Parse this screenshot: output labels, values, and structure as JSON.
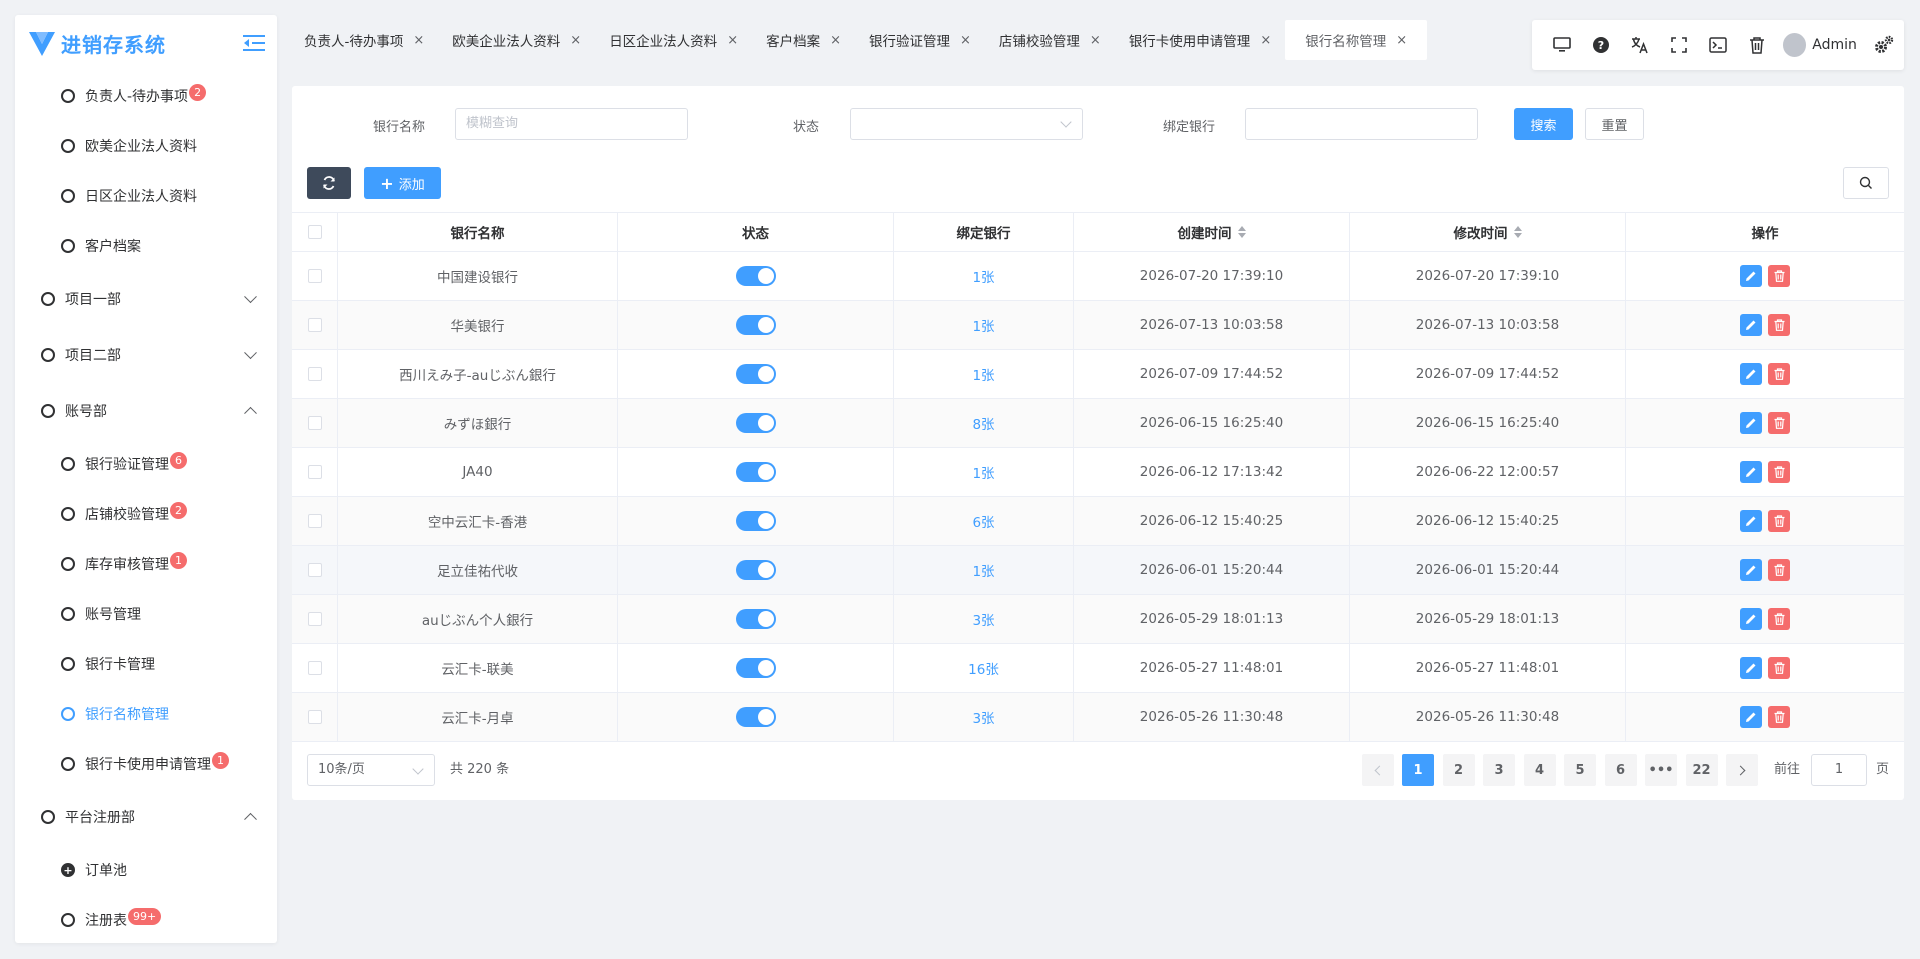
{
  "app": {
    "title": "进销存系统"
  },
  "sidebar": {
    "items": [
      {
        "label": "负责人-待办事项",
        "badge": "2",
        "type": "sub"
      },
      {
        "label": "欧美企业法人资料",
        "badge": "",
        "type": "sub"
      },
      {
        "label": "日区企业法人资料",
        "badge": "",
        "type": "sub"
      },
      {
        "label": "客户档案",
        "badge": "",
        "type": "sub"
      },
      {
        "label": "项目一部",
        "badge": "",
        "type": "group",
        "expanded": false
      },
      {
        "label": "项目二部",
        "badge": "",
        "type": "group",
        "expanded": false
      },
      {
        "label": "账号部",
        "badge": "",
        "type": "group",
        "expanded": true
      },
      {
        "label": "银行验证管理",
        "badge": "6",
        "type": "sub"
      },
      {
        "label": "店铺校验管理",
        "badge": "2",
        "type": "sub"
      },
      {
        "label": "库存审核管理",
        "badge": "1",
        "type": "sub"
      },
      {
        "label": "账号管理",
        "badge": "",
        "type": "sub"
      },
      {
        "label": "银行卡管理",
        "badge": "",
        "type": "sub"
      },
      {
        "label": "银行名称管理",
        "badge": "",
        "type": "sub",
        "active": true
      },
      {
        "label": "银行卡使用申请管理",
        "badge": "1",
        "type": "sub"
      },
      {
        "label": "平台注册部",
        "badge": "",
        "type": "group",
        "expanded": true
      },
      {
        "label": "订单池",
        "badge": "",
        "type": "sub",
        "plus": true
      },
      {
        "label": "注册表",
        "badge": "99+",
        "type": "sub"
      }
    ]
  },
  "tabs": [
    {
      "label": "负责人-待办事项",
      "active": false
    },
    {
      "label": "欧美企业法人资料",
      "active": false
    },
    {
      "label": "日区企业法人资料",
      "active": false
    },
    {
      "label": "客户档案",
      "active": false
    },
    {
      "label": "银行验证管理",
      "active": false
    },
    {
      "label": "店铺校验管理",
      "active": false
    },
    {
      "label": "银行卡使用申请管理",
      "active": false
    },
    {
      "label": "银行名称管理",
      "active": true
    }
  ],
  "tab_close": "×",
  "toolbar": {
    "user": "Admin"
  },
  "search": {
    "bank_name_label": "银行名称",
    "bank_name_placeholder": "模糊查询",
    "status_label": "状态",
    "bound_bank_label": "绑定银行",
    "search_button": "搜索",
    "reset_button": "重置"
  },
  "actions": {
    "add_button": "添加",
    "add_symbol": "+"
  },
  "table": {
    "headers": {
      "name": "银行名称",
      "status": "状态",
      "bound": "绑定银行",
      "created": "创建时间",
      "modified": "修改时间",
      "ops": "操作"
    },
    "rows": [
      {
        "name": "中国建设银行",
        "bound": "1张",
        "created": "2026-07-20 17:39:10",
        "modified": "2026-07-20 17:39:10",
        "enabled": true
      },
      {
        "name": "华美银行",
        "bound": "1张",
        "created": "2026-07-13 10:03:58",
        "modified": "2026-07-13 10:03:58",
        "enabled": true
      },
      {
        "name": "西川えみ子-auじぶん銀行",
        "bound": "1张",
        "created": "2026-07-09 17:44:52",
        "modified": "2026-07-09 17:44:52",
        "enabled": true
      },
      {
        "name": "みずほ銀行",
        "bound": "8张",
        "created": "2026-06-15 16:25:40",
        "modified": "2026-06-15 16:25:40",
        "enabled": true
      },
      {
        "name": "JA40",
        "bound": "1张",
        "created": "2026-06-12 17:13:42",
        "modified": "2026-06-22 12:00:57",
        "enabled": true
      },
      {
        "name": "空中云汇卡-香港",
        "bound": "6张",
        "created": "2026-06-12 15:40:25",
        "modified": "2026-06-12 15:40:25",
        "enabled": true
      },
      {
        "name": "足立佳祐代收",
        "bound": "1张",
        "created": "2026-06-01 15:20:44",
        "modified": "2026-06-01 15:20:44",
        "enabled": true
      },
      {
        "name": "auじぶん个人銀行",
        "bound": "3张",
        "created": "2026-05-29 18:01:13",
        "modified": "2026-05-29 18:01:13",
        "enabled": true
      },
      {
        "name": "云汇卡-联美",
        "bound": "16张",
        "created": "2026-05-27 11:48:01",
        "modified": "2026-05-27 11:48:01",
        "enabled": true
      },
      {
        "name": "云汇卡-月卓",
        "bound": "3张",
        "created": "2026-05-26 11:30:48",
        "modified": "2026-05-26 11:30:48",
        "enabled": true
      }
    ]
  },
  "pagination": {
    "page_size": "10条/页",
    "total": "共 220 条",
    "pages": [
      "1",
      "2",
      "3",
      "4",
      "5",
      "6",
      "•••",
      "22"
    ],
    "current": "1",
    "goto_prefix": "前往",
    "goto_value": "1",
    "goto_suffix": "页"
  },
  "colors": {
    "primary": "#409eff",
    "danger": "#f56c6c",
    "dark_button": "#3e4a5b"
  }
}
